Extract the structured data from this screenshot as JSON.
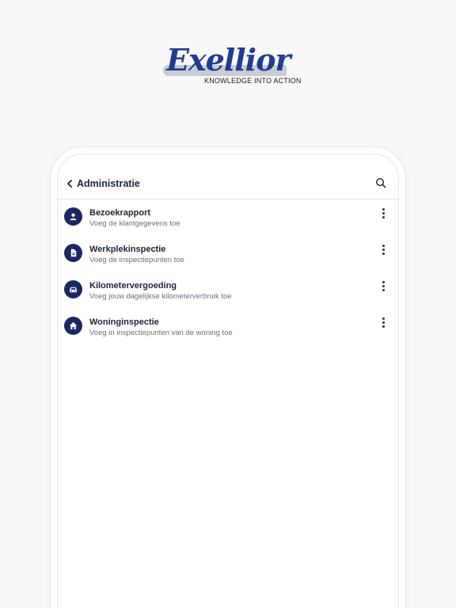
{
  "logo": {
    "word": "Exellior",
    "tagline": "KNOWLEDGE INTO ACTION",
    "color": "#1f3d8f"
  },
  "header": {
    "back_icon": "chevron-left-icon",
    "title": "Administratie",
    "search_icon": "search-icon"
  },
  "colors": {
    "accent": "#1c2663",
    "text": "#1d2433",
    "subtext": "#6b6f7a"
  },
  "items": [
    {
      "icon": "person-icon",
      "title": "Bezoekrapport",
      "subtitle": "Voeg de klantgegevens toe",
      "menu_icon": "more-vertical-icon"
    },
    {
      "icon": "document-icon",
      "title": "Werkplekinspectie",
      "subtitle": "Voeg de inspectiepunten toe",
      "menu_icon": "more-vertical-icon"
    },
    {
      "icon": "car-icon",
      "title": "Kilometervergoeding",
      "subtitle": "Voeg jouw dagelijkse kilometerverbruik toe",
      "menu_icon": "more-vertical-icon"
    },
    {
      "icon": "home-icon",
      "title": "Woninginspectie",
      "subtitle": "Voeg in inspectiepunten van de woning toe",
      "menu_icon": "more-vertical-icon"
    }
  ]
}
